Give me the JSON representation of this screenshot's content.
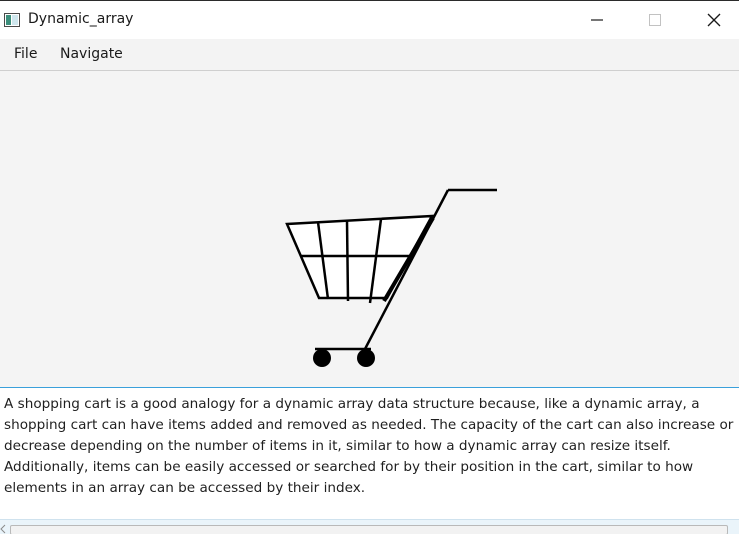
{
  "window": {
    "title": "Dynamic_array",
    "icon": "app-window-icon",
    "controls": [
      "minimize-icon",
      "maximize-icon",
      "close-icon"
    ]
  },
  "menu": {
    "items": [
      {
        "label": "File"
      },
      {
        "label": "Navigate"
      }
    ]
  },
  "illustration": {
    "icon": "shopping-cart-icon"
  },
  "description": {
    "text": "A shopping cart is a good analogy for a dynamic array data structure because, like a dynamic array, a shopping cart can have items added and removed as needed. The capacity of the cart can also increase or decrease depending on the number of items in it, similar to how a dynamic array can resize itself. Additionally, items can be easily accessed or searched for by their position in the cart, similar to how elements in an array can be accessed by their index."
  },
  "colors": {
    "focus_border": "#3aa0db",
    "canvas_bg": "#f4f4f4"
  }
}
